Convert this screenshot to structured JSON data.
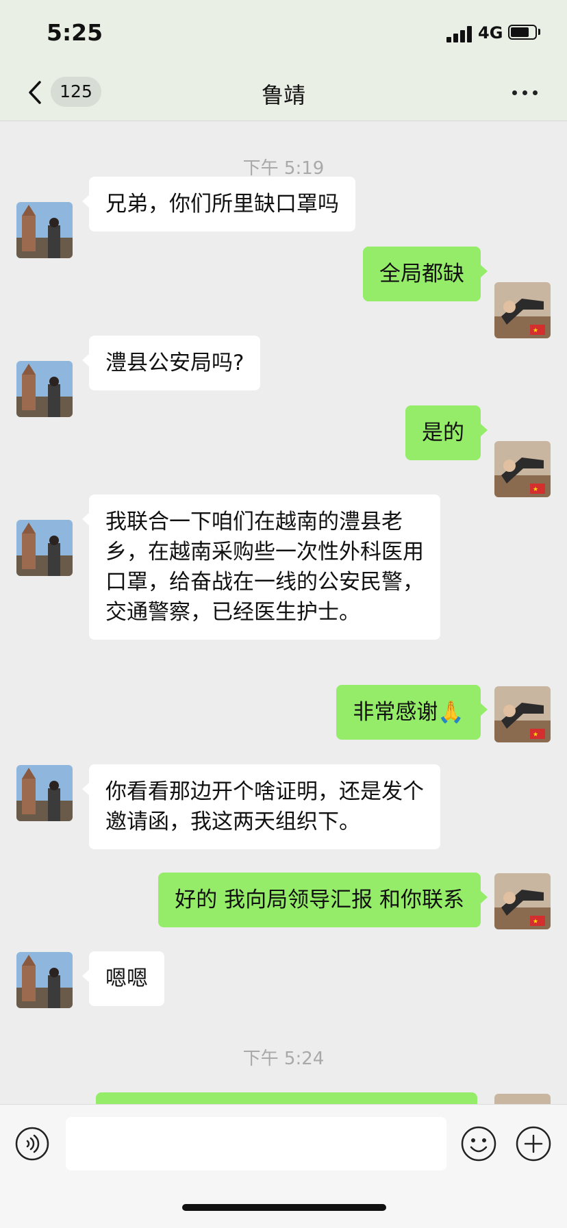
{
  "status_bar": {
    "time": "5:25",
    "network": "4G",
    "battery_level": 0.75
  },
  "header": {
    "unread_count": "125",
    "title": "鲁靖"
  },
  "colors": {
    "outgoing_bubble": "#95ec69",
    "incoming_bubble": "#ffffff",
    "background": "#ededed"
  },
  "timestamps": [
    "下午 5:19",
    "下午 5:24"
  ],
  "messages": [
    {
      "from": "contact",
      "text": "兄弟，你们所里缺口罩吗"
    },
    {
      "from": "me",
      "text": "全局都缺"
    },
    {
      "from": "contact",
      "text": "澧县公安局吗?"
    },
    {
      "from": "me",
      "text": "是的"
    },
    {
      "from": "contact",
      "text": "我联合一下咱们在越南的澧县老\n乡，在越南采购些一次性外科医用\n口罩，给奋战在一线的公安民警，\n交通警察，已经医生护士。"
    },
    {
      "from": "me",
      "text": "非常感谢🙏"
    },
    {
      "from": "contact",
      "text": "你看看那边开个啥证明，还是发个\n邀请函，我这两天组织下。"
    },
    {
      "from": "me",
      "text": "好的 我向局领导汇报 和你联系"
    },
    {
      "from": "contact",
      "text": "嗯嗯"
    },
    {
      "from": "me",
      "text": ""
    }
  ],
  "input_bar": {
    "placeholder": ""
  },
  "icons": {
    "back": "chevron-left-icon",
    "more": "more-icon",
    "voice": "voice-icon",
    "emoji": "emoji-icon",
    "plus": "plus-icon"
  }
}
